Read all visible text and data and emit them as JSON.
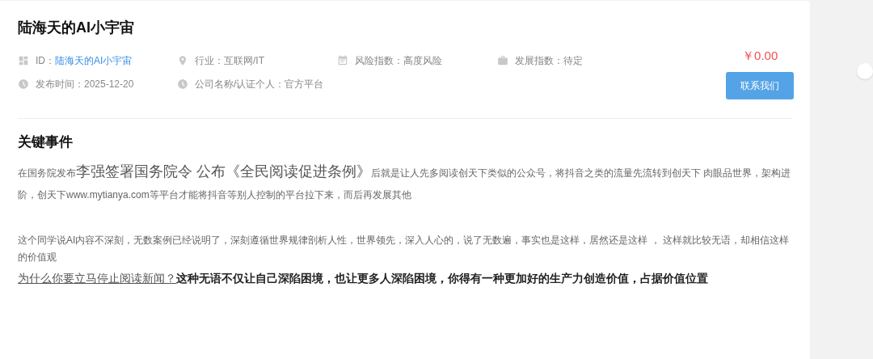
{
  "title": "陆海天的AI小宇宙",
  "meta": [
    {
      "kind": "id",
      "label": "ID：",
      "value": "陆海天的AI小宇宙",
      "link": true
    },
    {
      "kind": "industry",
      "label": "行业：",
      "value": "互联网/IT",
      "link": false
    },
    {
      "kind": "risk",
      "label": "风险指数：",
      "value": "高度风险",
      "link": false
    },
    {
      "kind": "growth",
      "label": "发展指数：",
      "value": "待定",
      "link": false
    },
    {
      "kind": "time",
      "label": "发布时间：",
      "value": "2025-12-20",
      "link": false
    },
    {
      "kind": "company",
      "label": "公司名称/认证个人：",
      "value": "官方平台",
      "link": false
    }
  ],
  "price": "￥0.00",
  "contact_button": "联系我们",
  "section_title": "关键事件",
  "paragraphs": [
    {
      "kind": "mixed",
      "runs": [
        {
          "kind": "plain",
          "text": "在国务院发布"
        },
        {
          "kind": "headline",
          "text": "李强签署国务院令 公布《全民阅读促进条例》"
        },
        {
          "kind": "plain",
          "text": "后就是让人先多阅读创天下类似的公众号，将抖音之类的流量先流转到创天下 肉眼品世界，架构进阶，创天下www.mytianya.com等平台才能将抖音等别人控制的平台拉下来，而后再发展其他"
        }
      ]
    },
    {
      "kind": "plain",
      "runs": [
        {
          "kind": "plain",
          "text": "这个同学说AI内容不深刻，无数案例已经说明了，深刻遵循世界规律剖析人性，世界领先，深入人心的，说了无数遍，事实也是这样，居然还是这样 ， 这样就比较无语，却相信这样的价值观"
        }
      ]
    },
    {
      "kind": "emphasis",
      "runs": [
        {
          "kind": "link",
          "text": "为什么你要立马停止阅读新闻？"
        },
        {
          "kind": "bold",
          "text": "这种无语不仅让自己深陷困境，也让更多人深陷困境，你得有一种更加好的生产力创造价值，占据价值位置"
        }
      ]
    }
  ]
}
